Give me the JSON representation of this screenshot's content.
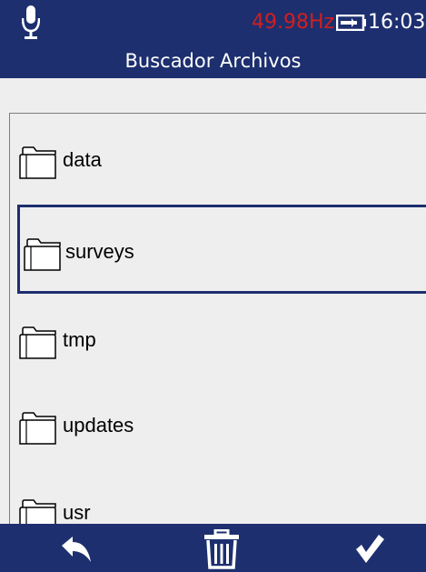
{
  "header": {
    "frequency": "49.98Hz",
    "time": "16:03",
    "title": "Buscador Archivos",
    "icons": {
      "mic": "microphone-icon",
      "battery": "battery-charging-icon"
    },
    "freq_color": "#d11f1f",
    "bar_color": "#1d2f6f"
  },
  "files": {
    "items": [
      {
        "label": "data",
        "icon": "folder-icon",
        "selected": false
      },
      {
        "label": "surveys",
        "icon": "folder-icon",
        "selected": true
      },
      {
        "label": "tmp",
        "icon": "folder-icon",
        "selected": false
      },
      {
        "label": "updates",
        "icon": "folder-icon",
        "selected": false
      },
      {
        "label": "usr",
        "icon": "folder-icon",
        "selected": false
      }
    ]
  },
  "footer": {
    "buttons": [
      {
        "icon": "back-arrow-icon"
      },
      {
        "icon": "trash-icon"
      },
      {
        "icon": "checkmark-icon"
      }
    ]
  }
}
